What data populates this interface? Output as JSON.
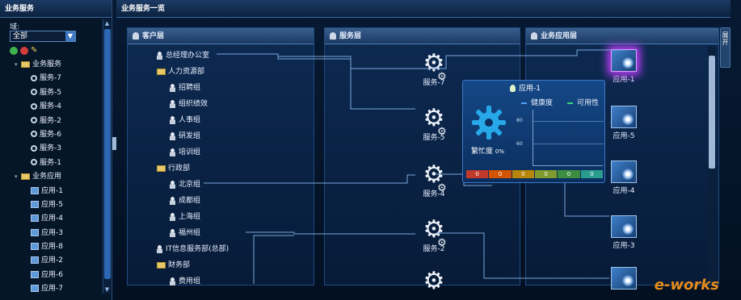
{
  "left_panel": {
    "title": "业务服务",
    "domain_label": "域:",
    "domain_value": "全部",
    "tree": [
      {
        "label": "业务服务",
        "level": 0,
        "type": "folder"
      },
      {
        "label": "服务-7",
        "level": 1,
        "type": "service"
      },
      {
        "label": "服务-5",
        "level": 1,
        "type": "service"
      },
      {
        "label": "服务-4",
        "level": 1,
        "type": "service"
      },
      {
        "label": "服务-2",
        "level": 1,
        "type": "service"
      },
      {
        "label": "服务-6",
        "level": 1,
        "type": "service"
      },
      {
        "label": "服务-3",
        "level": 1,
        "type": "service"
      },
      {
        "label": "服务-1",
        "level": 1,
        "type": "service"
      },
      {
        "label": "业务应用",
        "level": 0,
        "type": "folder"
      },
      {
        "label": "应用-1",
        "level": 1,
        "type": "app"
      },
      {
        "label": "应用-5",
        "level": 1,
        "type": "app"
      },
      {
        "label": "应用-4",
        "level": 1,
        "type": "app"
      },
      {
        "label": "应用-3",
        "level": 1,
        "type": "app"
      },
      {
        "label": "应用-8",
        "level": 1,
        "type": "app"
      },
      {
        "label": "应用-2",
        "level": 1,
        "type": "app"
      },
      {
        "label": "应用-6",
        "level": 1,
        "type": "app"
      },
      {
        "label": "应用-7",
        "level": 1,
        "type": "app"
      }
    ]
  },
  "main": {
    "title": "业务服务一览",
    "customer_layer": {
      "title": "客户层",
      "items": [
        {
          "label": "总经理办公室",
          "indent": 1,
          "type": "person"
        },
        {
          "label": "人力资源部",
          "indent": 1,
          "type": "folder"
        },
        {
          "label": "招聘组",
          "indent": 2,
          "type": "person"
        },
        {
          "label": "组织绩效",
          "indent": 2,
          "type": "person"
        },
        {
          "label": "人事组",
          "indent": 2,
          "type": "person"
        },
        {
          "label": "研发组",
          "indent": 2,
          "type": "person"
        },
        {
          "label": "培训组",
          "indent": 2,
          "type": "person"
        },
        {
          "label": "行政部",
          "indent": 1,
          "type": "folder"
        },
        {
          "label": "北京组",
          "indent": 2,
          "type": "person"
        },
        {
          "label": "成都组",
          "indent": 2,
          "type": "person"
        },
        {
          "label": "上海组",
          "indent": 2,
          "type": "person"
        },
        {
          "label": "福州组",
          "indent": 2,
          "type": "person"
        },
        {
          "label": "IT信息服务部(总部)",
          "indent": 1,
          "type": "person"
        },
        {
          "label": "财务部",
          "indent": 1,
          "type": "folder"
        },
        {
          "label": "费用组",
          "indent": 2,
          "type": "person"
        }
      ]
    },
    "service_layer": {
      "title": "服务层",
      "services": [
        "服务-7",
        "服务-5",
        "服务-4",
        "服务-2"
      ]
    },
    "app_layer": {
      "title": "业务应用层",
      "apps": [
        "应用-1",
        "应用-5",
        "应用-4",
        "应用-3"
      ]
    },
    "side_tab": "展开"
  },
  "popup": {
    "title": "应用-1",
    "legend_health": "健康度",
    "legend_avail": "可用性",
    "busy_label": "繁忙度",
    "busy_value": "0%",
    "tick_80": "80",
    "tick_60": "60",
    "status_counts": [
      "0",
      "0",
      "0",
      "0",
      "0",
      "0"
    ],
    "status_colors": [
      "#c0392b",
      "#d35400",
      "#b8860b",
      "#7f9a2e",
      "#3e8e41",
      "#2a9d8f"
    ],
    "legend_health_color": "#4fa3ff",
    "legend_avail_color": "#39d27a"
  },
  "watermark": "e-works"
}
